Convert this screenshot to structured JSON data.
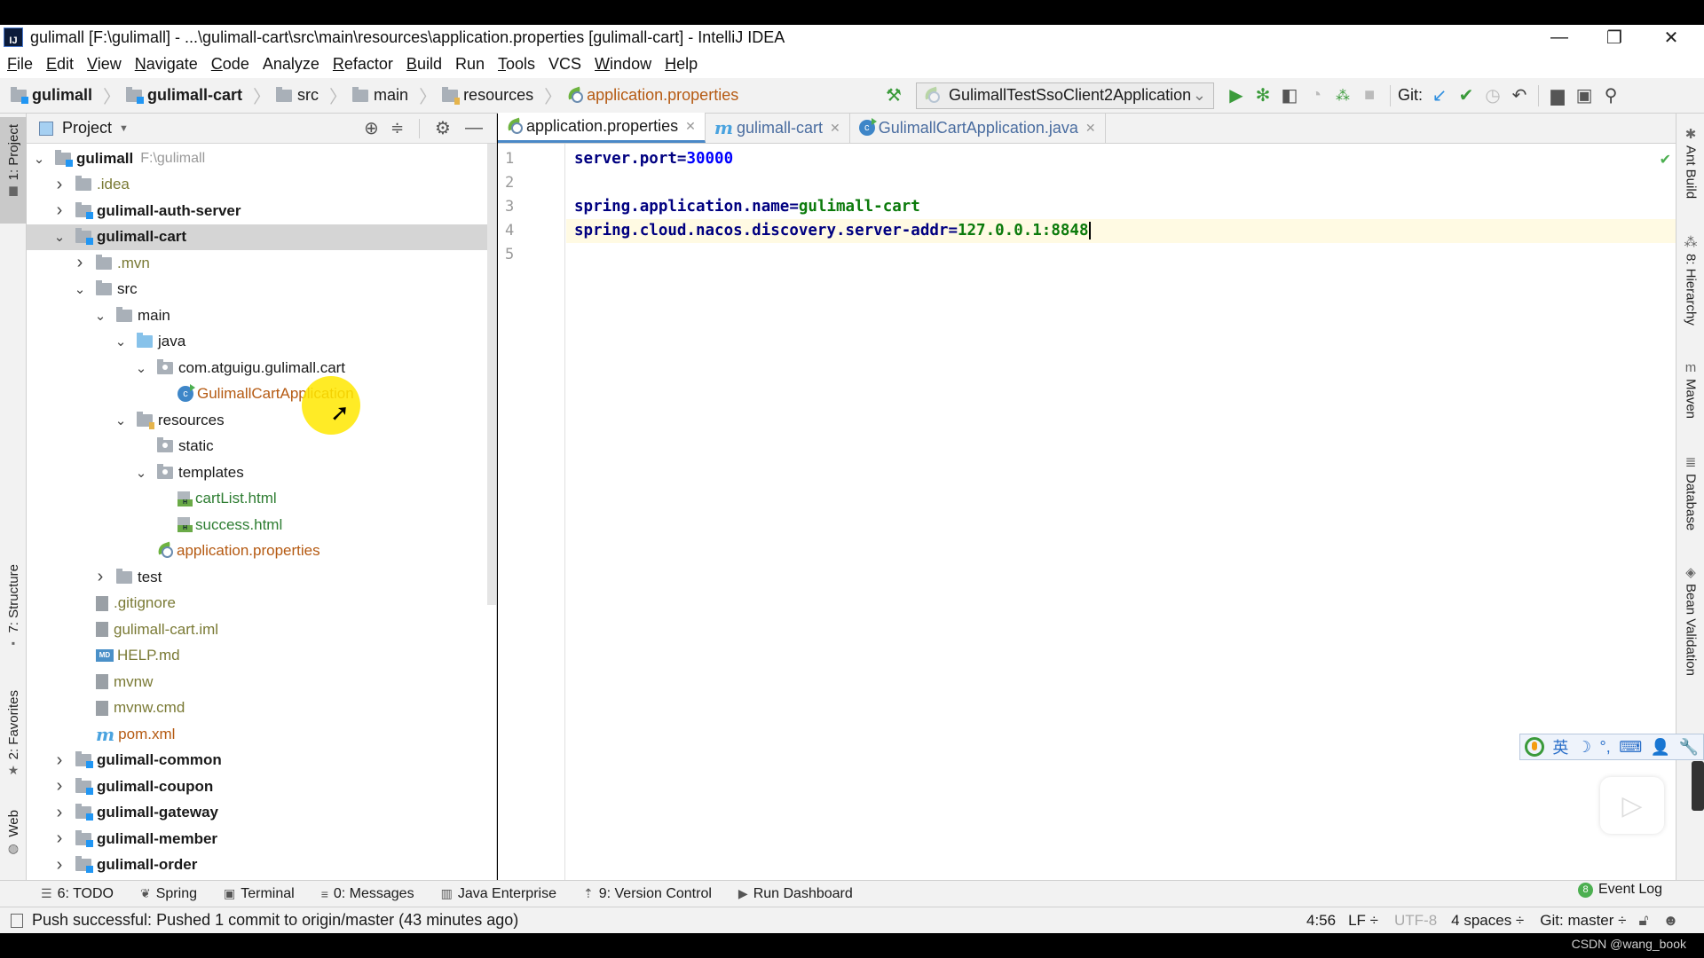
{
  "window": {
    "title": "gulimall [F:\\gulimall] - ...\\gulimall-cart\\src\\main\\resources\\application.properties [gulimall-cart] - IntelliJ IDEA",
    "logo_text": "IJ",
    "controls": {
      "minimize": "—",
      "restore": "❐",
      "close": "✕"
    }
  },
  "menu": [
    {
      "label": "File",
      "mn": "F",
      "rest": "ile"
    },
    {
      "label": "Edit",
      "mn": "E",
      "rest": "dit"
    },
    {
      "label": "View",
      "mn": "V",
      "rest": "iew"
    },
    {
      "label": "Navigate",
      "mn": "N",
      "rest": "avigate"
    },
    {
      "label": "Code",
      "mn": "C",
      "rest": "ode"
    },
    {
      "label": "Analyze",
      "mn": "",
      "rest": "Analyze"
    },
    {
      "label": "Refactor",
      "mn": "R",
      "rest": "efactor"
    },
    {
      "label": "Build",
      "mn": "B",
      "rest": "uild"
    },
    {
      "label": "Run",
      "mn": "",
      "rest": "Run"
    },
    {
      "label": "Tools",
      "mn": "T",
      "rest": "ools"
    },
    {
      "label": "VCS",
      "mn": "",
      "rest": "VCS"
    },
    {
      "label": "Window",
      "mn": "W",
      "rest": "indow"
    },
    {
      "label": "Help",
      "mn": "H",
      "rest": "elp"
    }
  ],
  "breadcrumb": [
    "gulimall",
    "gulimall-cart",
    "src",
    "main",
    "resources",
    "application.properties"
  ],
  "toolbar": {
    "run_config": "GulimallTestSsoClient2Application",
    "git_label": "Git:",
    "icons": [
      "build-hammer-icon",
      "run-icon",
      "debug-icon",
      "coverage-icon",
      "profile-icon",
      "attach-debugger-icon",
      "stop-icon",
      "vcs-update-icon",
      "vcs-commit-icon",
      "vcs-history-icon",
      "vcs-revert-icon",
      "project-structure-icon",
      "presentation-icon",
      "search-everywhere-icon"
    ]
  },
  "left_tool_tabs": [
    "1: Project",
    "7: Structure",
    "2: Favorites",
    "Web"
  ],
  "right_tool_tabs": [
    "Ant Build",
    "8: Hierarchy",
    "Maven",
    "Database",
    "Bean Validation"
  ],
  "project_panel": {
    "header": "Project",
    "tree": [
      {
        "label": "gulimall",
        "suffix": "F:\\gulimall",
        "level": 0,
        "expanded": true,
        "type": "module",
        "bold": true
      },
      {
        "label": ".idea",
        "level": 1,
        "expanded": false,
        "type": "folder",
        "dim": true
      },
      {
        "label": "gulimall-auth-server",
        "level": 1,
        "expanded": false,
        "type": "module",
        "bold": true
      },
      {
        "label": "gulimall-cart",
        "level": 1,
        "expanded": true,
        "type": "module",
        "bold": true,
        "selected": true
      },
      {
        "label": ".mvn",
        "level": 2,
        "expanded": false,
        "type": "folder",
        "dim": true
      },
      {
        "label": "src",
        "level": 2,
        "expanded": true,
        "type": "folder"
      },
      {
        "label": "main",
        "level": 3,
        "expanded": true,
        "type": "folder"
      },
      {
        "label": "java",
        "level": 4,
        "expanded": true,
        "type": "source-folder"
      },
      {
        "label": "com.atguigu.gulimall.cart",
        "level": 5,
        "expanded": true,
        "type": "package"
      },
      {
        "label": "GulimallCartApplication",
        "level": 6,
        "type": "class",
        "color": "orange"
      },
      {
        "label": "resources",
        "level": 4,
        "expanded": true,
        "type": "resource-folder"
      },
      {
        "label": "static",
        "level": 5,
        "type": "package"
      },
      {
        "label": "templates",
        "level": 5,
        "expanded": true,
        "type": "package"
      },
      {
        "label": "cartList.html",
        "level": 6,
        "type": "html",
        "color": "green"
      },
      {
        "label": "success.html",
        "level": 6,
        "type": "html",
        "color": "green"
      },
      {
        "label": "application.properties",
        "level": 5,
        "type": "properties",
        "color": "orange"
      },
      {
        "label": "test",
        "level": 3,
        "expanded": false,
        "type": "folder"
      },
      {
        "label": ".gitignore",
        "level": 2,
        "type": "file",
        "dim": true
      },
      {
        "label": "gulimall-cart.iml",
        "level": 2,
        "type": "file",
        "dim": true
      },
      {
        "label": "HELP.md",
        "level": 2,
        "type": "md",
        "dim": true
      },
      {
        "label": "mvnw",
        "level": 2,
        "type": "file",
        "dim": true
      },
      {
        "label": "mvnw.cmd",
        "level": 2,
        "type": "file",
        "dim": true
      },
      {
        "label": "pom.xml",
        "level": 2,
        "type": "maven",
        "color": "orange"
      },
      {
        "label": "gulimall-common",
        "level": 1,
        "expanded": false,
        "type": "module",
        "bold": true
      },
      {
        "label": "gulimall-coupon",
        "level": 1,
        "expanded": false,
        "type": "module",
        "bold": true
      },
      {
        "label": "gulimall-gateway",
        "level": 1,
        "expanded": false,
        "type": "module",
        "bold": true
      },
      {
        "label": "gulimall-member",
        "level": 1,
        "expanded": false,
        "type": "module",
        "bold": true
      },
      {
        "label": "gulimall-order",
        "level": 1,
        "expanded": false,
        "type": "module",
        "bold": true
      }
    ]
  },
  "editor": {
    "tabs": [
      {
        "label": "application.properties",
        "icon": "spring-properties-icon",
        "active": true
      },
      {
        "label": "gulimall-cart",
        "icon": "maven-icon",
        "active": false
      },
      {
        "label": "GulimallCartApplication.java",
        "icon": "java-class-icon",
        "active": false
      }
    ],
    "lines": [
      {
        "n": "1",
        "key": "server.port",
        "eq": "=",
        "val": "30000",
        "valtype": "num"
      },
      {
        "n": "2",
        "key": "",
        "eq": "",
        "val": ""
      },
      {
        "n": "3",
        "key": "spring.application.name",
        "eq": "=",
        "val": "gulimall-cart",
        "valtype": "str"
      },
      {
        "n": "4",
        "key": "spring.cloud.nacos.discovery.server-addr",
        "eq": "=",
        "val": "127.0.0.1:8848",
        "valtype": "str",
        "current": true
      },
      {
        "n": "5",
        "key": "",
        "eq": "",
        "val": ""
      }
    ]
  },
  "bottom_tools": [
    {
      "label": "6: TODO",
      "icon": "todo-icon"
    },
    {
      "label": "Spring",
      "icon": "spring-icon"
    },
    {
      "label": "Terminal",
      "icon": "terminal-icon"
    },
    {
      "label": "0: Messages",
      "icon": "messages-icon"
    },
    {
      "label": "Java Enterprise",
      "icon": "java-enterprise-icon"
    },
    {
      "label": "9: Version Control",
      "icon": "version-control-icon"
    },
    {
      "label": "Run Dashboard",
      "icon": "run-dashboard-icon"
    }
  ],
  "event_log": {
    "label": "Event Log",
    "count": "8"
  },
  "status": {
    "message": "Push successful: Pushed 1 commit to origin/master (43 minutes ago)",
    "position": "4:56",
    "line_sep": "LF ÷",
    "encoding": "UTF-8",
    "indent": "4 spaces ÷",
    "branch": "Git: master ÷"
  },
  "ime_toolbar": [
    "英",
    "☽",
    "°,",
    "⌨",
    "👤",
    "🔧"
  ],
  "watermark": "CSDN @wang_book"
}
